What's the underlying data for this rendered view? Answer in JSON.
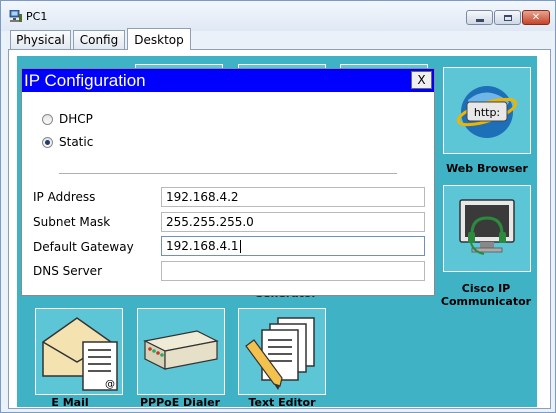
{
  "window": {
    "title": "PC1"
  },
  "tabs": [
    {
      "label": "Physical",
      "active": false
    },
    {
      "label": "Config",
      "active": false
    },
    {
      "label": "Desktop",
      "active": true
    }
  ],
  "dialog": {
    "title": "IP Configuration",
    "close_label": "X",
    "ip_mode": {
      "options": [
        {
          "label": "DHCP",
          "checked": false
        },
        {
          "label": "Static",
          "checked": true
        }
      ]
    },
    "fields": [
      {
        "label": "IP Address",
        "value": "192.168.4.2"
      },
      {
        "label": "Subnet Mask",
        "value": "255.255.255.0"
      },
      {
        "label": "Default Gateway",
        "value": "192.168.4.1",
        "focused": true
      },
      {
        "label": "DNS Server",
        "value": ""
      }
    ]
  },
  "apps": [
    {
      "label": "Web Browser",
      "icon": "web-browser-icon",
      "icon_text": "http:"
    },
    {
      "label": "Cisco IP\nCommunicator",
      "icon": "cisco-ip-communicator-icon"
    },
    {
      "label": "E Mail",
      "icon": "email-icon"
    },
    {
      "label": "PPPoE Dialer",
      "icon": "pppoe-dialer-icon"
    },
    {
      "label": "Text Editor",
      "icon": "text-editor-icon"
    }
  ],
  "partial_label": "Generator",
  "colors": {
    "desktop_bg": "#3fb2c6",
    "tile_bg": "#5cc6d6",
    "dialog_header": "#0000ff"
  }
}
